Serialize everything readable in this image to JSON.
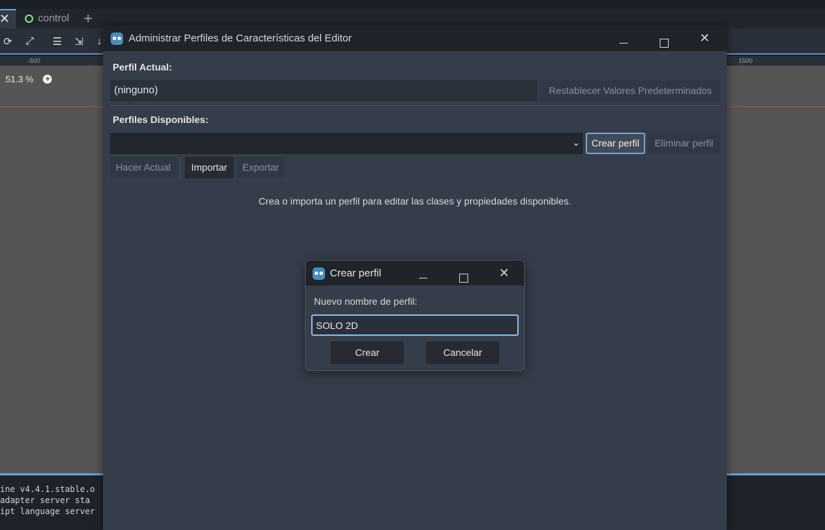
{
  "editor": {
    "close_glyph": "✕",
    "tab_name": "control",
    "add_tab_glyph": "+",
    "toolbar_icons": [
      "rotate-icon",
      "expand-icon",
      "list-select-icon",
      "pointer-select-icon",
      "arrow-icon"
    ],
    "ruler_marks": [
      "-500",
      "1500"
    ],
    "zoom_level": "51.3 %",
    "zoom_plus": "+",
    "console_lines": [
      "ine v4.4.1.stable.o",
      " adapter server sta",
      "ipt language server"
    ]
  },
  "dialog": {
    "title": "Administrar Perfiles de Características del Editor",
    "current_profile_label": "Perfil Actual:",
    "current_profile_value": "(ninguno)",
    "reset_button": "Restablecer Valores Predeterminados",
    "available_profiles_label": "Perfiles Disponibles:",
    "profile_select_value": "",
    "create_profile_button": "Crear perfil",
    "delete_profile_button": "Eliminar perfil",
    "make_current_button": "Hacer Actual",
    "import_button": "Importar",
    "export_button": "Exportar",
    "hint_text": "Crea o importa un perfil para editar las clases y propiedades disponibles."
  },
  "subdialog": {
    "title": "Crear perfil",
    "name_label": "Nuevo nombre de perfil:",
    "name_value": "SOLO 2D",
    "create_button": "Crear",
    "cancel_button": "Cancelar"
  },
  "colors": {
    "accent": "#78a6d6",
    "dialog_bg": "#363d4a",
    "titlebar_bg": "#1f232a",
    "godot_blue": "#478cbf"
  }
}
